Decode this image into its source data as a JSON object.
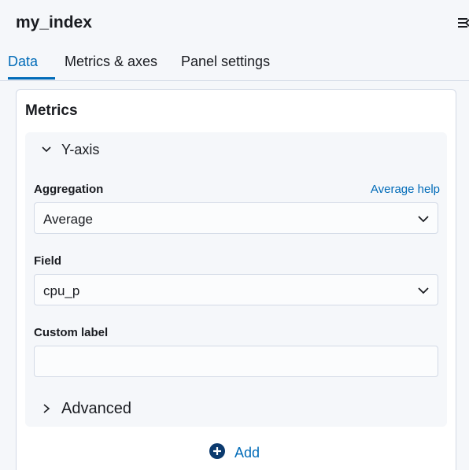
{
  "header": {
    "index_name": "my_index",
    "collapse_icon": "menu-collapse-icon"
  },
  "tabs": [
    {
      "label": "Data",
      "active": true
    },
    {
      "label": "Metrics & axes",
      "active": false
    },
    {
      "label": "Panel settings",
      "active": false
    }
  ],
  "metrics": {
    "title": "Metrics",
    "yaxis": {
      "label": "Y-axis",
      "expanded": true,
      "aggregation": {
        "label": "Aggregation",
        "help_link": "Average help",
        "value": "Average"
      },
      "field": {
        "label": "Field",
        "value": "cpu_p"
      },
      "custom_label": {
        "label": "Custom label",
        "value": ""
      },
      "advanced": {
        "label": "Advanced",
        "expanded": false
      }
    },
    "add_label": "Add"
  },
  "colors": {
    "accent": "#006bb8",
    "background": "#f5f7fa",
    "border": "#d3dae6"
  }
}
